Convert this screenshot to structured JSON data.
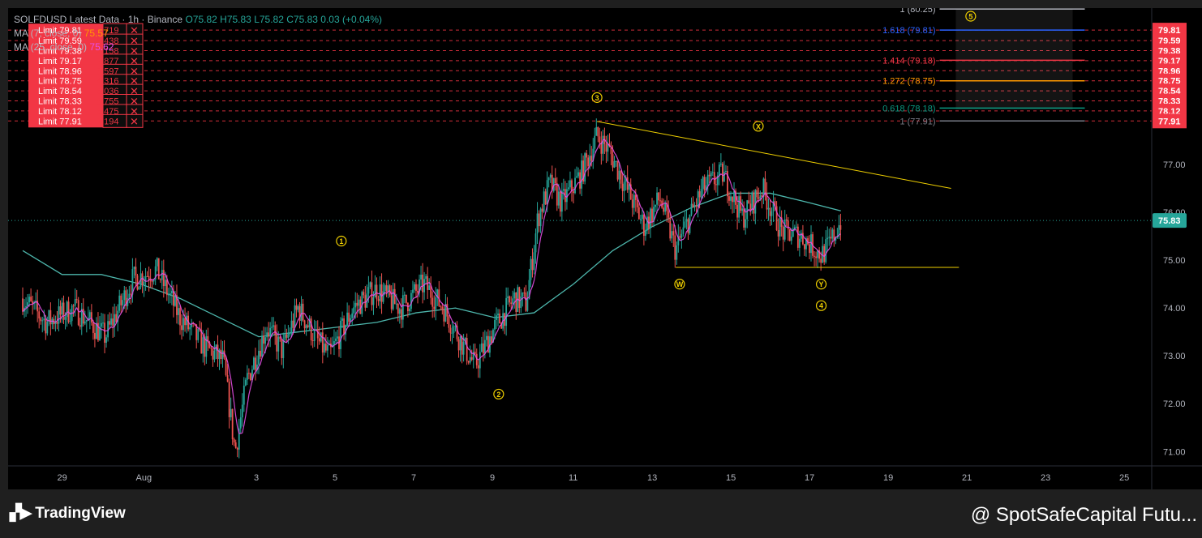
{
  "header": {
    "title": "SOLFDUSD Latest Data · 1h · Binance",
    "open": "O75.82",
    "high": "H75.83",
    "low": "L75.82",
    "close": "C75.83",
    "change": "0.03 (+0.04%)",
    "ma7_label": "MA (7, close, 0)",
    "ma7_value": "75.57",
    "ma25_label": "MA (25, close, 0)",
    "ma25_value": "75.62",
    "ma99_value": "76.03"
  },
  "orders": [
    {
      "label": "Limit 79.81",
      "qty": "0.719",
      "price": 79.81
    },
    {
      "label": "Limit 79.59",
      "qty": "1.438",
      "price": 79.59
    },
    {
      "label": "Limit 79.38",
      "qty": "2.158",
      "price": 79.38
    },
    {
      "label": "Limit 79.17",
      "qty": "2.877",
      "price": 79.17
    },
    {
      "label": "Limit 78.96",
      "qty": "3.597",
      "price": 78.96
    },
    {
      "label": "Limit 78.75",
      "qty": "4.316",
      "price": 78.75
    },
    {
      "label": "Limit 78.54",
      "qty": "5.036",
      "price": 78.54
    },
    {
      "label": "Limit 78.33",
      "qty": "5.755",
      "price": 78.33
    },
    {
      "label": "Limit 78.12",
      "qty": "6.475",
      "price": 78.12
    },
    {
      "label": "Limit 77.91",
      "qty": "7.194",
      "price": 77.91
    }
  ],
  "chart_data": {
    "type": "candlestick",
    "symbol": "SOLFDUSD",
    "interval": "1h",
    "x_ticks": [
      "29",
      "Aug",
      "3",
      "5",
      "7",
      "9",
      "11",
      "13",
      "15",
      "17",
      "19",
      "21",
      "23",
      "25"
    ],
    "y_ticks": [
      71.0,
      72.0,
      73.0,
      74.0,
      75.0,
      76.0,
      77.0
    ],
    "ylim": [
      70.7,
      80.1
    ],
    "last_price": 75.83,
    "price_line_colors": {
      "up": "#26a69a",
      "down": "#ef5350",
      "ma7": "#e64ee6",
      "ma25": "#4db6ac",
      "last": "#26a69a",
      "order": "#f23645",
      "trend": "#f0d000"
    },
    "price_path": [
      {
        "day": 28.0,
        "p": 74.2
      },
      {
        "day": 28.6,
        "p": 73.7
      },
      {
        "day": 29.3,
        "p": 74.0
      },
      {
        "day": 30.1,
        "p": 73.4
      },
      {
        "day": 30.8,
        "p": 74.6
      },
      {
        "day": 31.4,
        "p": 74.8
      },
      {
        "day": 32.0,
        "p": 73.8
      },
      {
        "day": 32.6,
        "p": 73.2
      },
      {
        "day": 33.1,
        "p": 72.9
      },
      {
        "day": 33.4,
        "p": 71.0
      },
      {
        "day": 33.7,
        "p": 72.5
      },
      {
        "day": 34.2,
        "p": 73.6
      },
      {
        "day": 34.6,
        "p": 73.1
      },
      {
        "day": 35.0,
        "p": 74.0
      },
      {
        "day": 35.5,
        "p": 73.3
      },
      {
        "day": 35.8,
        "p": 73.0
      },
      {
        "day": 36.4,
        "p": 74.0
      },
      {
        "day": 37.0,
        "p": 74.4
      },
      {
        "day": 37.6,
        "p": 74.0
      },
      {
        "day": 38.2,
        "p": 74.5
      },
      {
        "day": 38.7,
        "p": 74.0
      },
      {
        "day": 39.2,
        "p": 73.2
      },
      {
        "day": 39.5,
        "p": 72.8
      },
      {
        "day": 40.0,
        "p": 73.6
      },
      {
        "day": 40.5,
        "p": 74.2
      },
      {
        "day": 40.8,
        "p": 74.1
      },
      {
        "day": 41.1,
        "p": 75.9
      },
      {
        "day": 41.4,
        "p": 76.6
      },
      {
        "day": 41.7,
        "p": 76.2
      },
      {
        "day": 42.2,
        "p": 76.8
      },
      {
        "day": 42.6,
        "p": 77.6
      },
      {
        "day": 42.9,
        "p": 77.3
      },
      {
        "day": 43.3,
        "p": 76.6
      },
      {
        "day": 43.8,
        "p": 75.7
      },
      {
        "day": 44.2,
        "p": 76.3
      },
      {
        "day": 44.6,
        "p": 75.2
      },
      {
        "day": 44.9,
        "p": 75.8
      },
      {
        "day": 45.3,
        "p": 76.5
      },
      {
        "day": 45.8,
        "p": 76.8
      },
      {
        "day": 46.3,
        "p": 75.9
      },
      {
        "day": 46.8,
        "p": 76.5
      },
      {
        "day": 47.3,
        "p": 75.6
      },
      {
        "day": 47.8,
        "p": 75.5
      },
      {
        "day": 48.3,
        "p": 75.1
      },
      {
        "day": 48.5,
        "p": 75.3
      },
      {
        "day": 48.8,
        "p": 75.83
      }
    ],
    "ma25_path": [
      {
        "day": 28.0,
        "p": 75.2
      },
      {
        "day": 29.0,
        "p": 74.7
      },
      {
        "day": 30.0,
        "p": 74.7
      },
      {
        "day": 31.0,
        "p": 74.5
      },
      {
        "day": 32.0,
        "p": 74.2
      },
      {
        "day": 33.0,
        "p": 73.8
      },
      {
        "day": 34.0,
        "p": 73.4
      },
      {
        "day": 35.0,
        "p": 73.5
      },
      {
        "day": 36.0,
        "p": 73.6
      },
      {
        "day": 37.0,
        "p": 73.7
      },
      {
        "day": 38.0,
        "p": 73.9
      },
      {
        "day": 39.0,
        "p": 74.0
      },
      {
        "day": 40.0,
        "p": 73.8
      },
      {
        "day": 41.0,
        "p": 73.9
      },
      {
        "day": 42.0,
        "p": 74.5
      },
      {
        "day": 43.0,
        "p": 75.2
      },
      {
        "day": 44.0,
        "p": 75.7
      },
      {
        "day": 45.0,
        "p": 76.1
      },
      {
        "day": 46.0,
        "p": 76.4
      },
      {
        "day": 47.0,
        "p": 76.4
      },
      {
        "day": 48.0,
        "p": 76.2
      },
      {
        "day": 48.8,
        "p": 76.03
      }
    ],
    "annotations": [
      {
        "text": "1",
        "day": 36.1,
        "p": 75.4,
        "color": "#f0d000"
      },
      {
        "text": "2",
        "day": 40.1,
        "p": 72.2,
        "color": "#f0d000"
      },
      {
        "text": "3",
        "day": 42.6,
        "p": 78.4,
        "color": "#f0d000"
      },
      {
        "text": "W",
        "day": 44.7,
        "p": 74.5,
        "color": "#f0d000"
      },
      {
        "text": "X",
        "day": 46.7,
        "p": 77.8,
        "color": "#f0d000"
      },
      {
        "text": "Y",
        "day": 48.3,
        "p": 74.5,
        "color": "#f0d000"
      },
      {
        "text": "4",
        "day": 48.3,
        "p": 74.05,
        "color": "#f0d000"
      },
      {
        "text": "5",
        "day": 52.1,
        "p": 80.1,
        "color": "#f0d000"
      }
    ],
    "trendlines": [
      {
        "from": {
          "day": 42.6,
          "p": 77.9
        },
        "to": {
          "day": 51.6,
          "p": 76.5
        }
      },
      {
        "from": {
          "day": 44.6,
          "p": 74.85
        },
        "to": {
          "day": 51.8,
          "p": 74.85
        }
      }
    ],
    "fib_levels": [
      {
        "label": "1 (80.25)",
        "price": 80.25,
        "color": "#b2b5be"
      },
      {
        "label": "1.618 (79.81)",
        "price": 79.81,
        "color": "#2962ff"
      },
      {
        "label": "1.414 (79.18)",
        "price": 79.18,
        "color": "#f23645"
      },
      {
        "label": "1.272 (78.75)",
        "price": 78.75,
        "color": "#ff9800"
      },
      {
        "label": "0.618 (78.18)",
        "price": 78.18,
        "color": "#089981"
      },
      {
        "label": "1 (77.91)",
        "price": 77.91,
        "color": "#787b86"
      }
    ],
    "fib_range_days": [
      51.0,
      55.0
    ]
  },
  "footer": {
    "logo_text": "TradingView",
    "watermark": "@ SpotSafeCapital Futu..."
  }
}
